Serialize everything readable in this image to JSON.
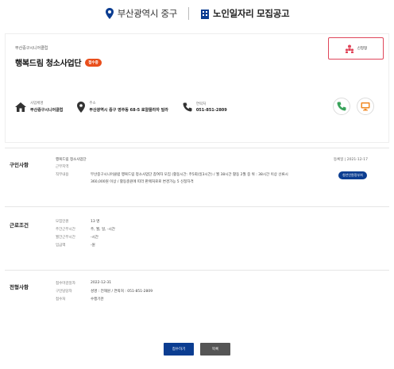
{
  "header": {
    "region": "부산광역시 중구",
    "title": "노인일자리 모집공고"
  },
  "post": {
    "org": "부산중구시니어클럽",
    "title": "행복드림 청소사업단",
    "status_badge": "접수중",
    "apply_label": "신청형",
    "info": [
      {
        "label": "사업체명",
        "value": "부산중구시니어클럽"
      },
      {
        "label": "주소",
        "value": "부산광역시 중구 영주동 68-5 로얄플라자 빌라"
      },
      {
        "label": "연락처",
        "value": "051-851-2809"
      }
    ]
  },
  "recruit": {
    "title": "구인사항",
    "field1_key": "행복드림 청소사업단",
    "field2_key": "근무지역",
    "field3_key": "직무내용",
    "field3_value": "부산중구시니어클럽 행복드림 청소사업단 참여자 모집 (활동시간: 주5회(일3시간) / 월 38시간 활동 2월 중 위 : 38시간 이상 선류시",
    "field3_value2": "360,000원 이상 / 활동충원에 따라 판매처로로 변경가능 5 신청자격",
    "date_label": "등록일 | 2021-12-17",
    "pill_label": "청년인원정부처"
  },
  "conditions": {
    "title": "근로조건",
    "rows": [
      {
        "k": "모집인원",
        "v": "13 명"
      },
      {
        "k": "주간근무시간",
        "v": "주, 월, 일, -시간"
      },
      {
        "k": "월간근무시간",
        "v": "-시간"
      },
      {
        "k": "임금액",
        "v": "-원"
      }
    ]
  },
  "selection": {
    "title": "전형사항",
    "rows": [
      {
        "k": "접수마감일자",
        "v": "2022-12-31"
      },
      {
        "k": "구인담당자",
        "v": "성명 : 전해원 / 연락처 : 051-851-2809"
      },
      {
        "k": "접수처",
        "v": "수행기관"
      }
    ]
  },
  "footer": {
    "primary_label": "접수하기",
    "secondary_label": "목록"
  },
  "colors": {
    "accent_blue": "#0b3d91",
    "badge_orange": "#e94e1b",
    "apply_red": "#e0465a",
    "phone_green": "#3aa35b",
    "monitor_orange": "#f08a24"
  }
}
